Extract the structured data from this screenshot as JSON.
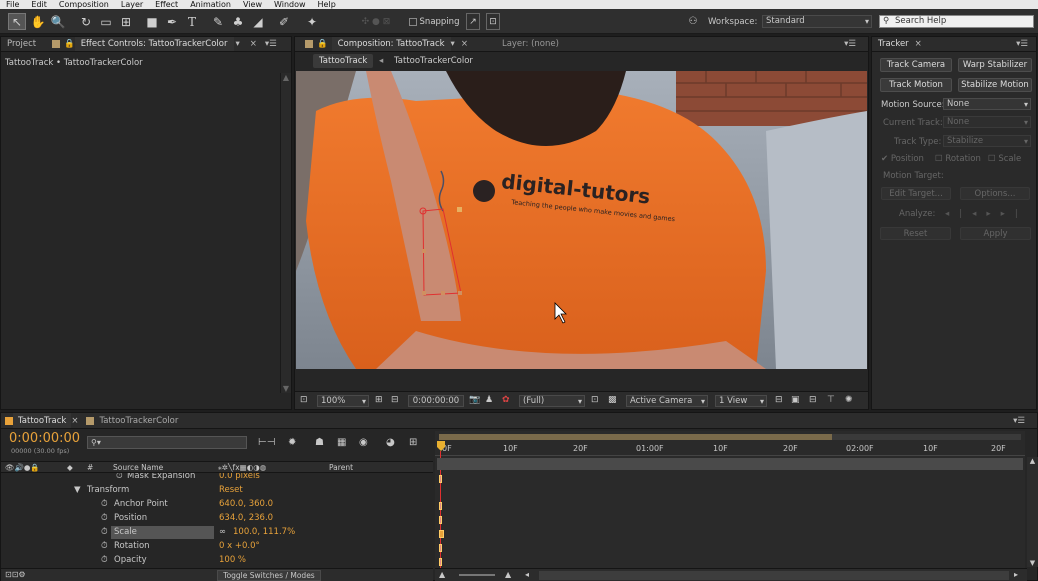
{
  "menu": [
    "File",
    "Edit",
    "Composition",
    "Layer",
    "Effect",
    "Animation",
    "View",
    "Window",
    "Help"
  ],
  "toolbar": {
    "snapping": "Snapping",
    "workspace_label": "Workspace:",
    "workspace_value": "Standard",
    "search_help": "Search Help"
  },
  "left_panel": {
    "tab_project": "Project",
    "tab_effects": "Effect Controls: TattooTrackerColor",
    "breadcrumb": "TattooTrack • TattooTrackerColor"
  },
  "comp_panel": {
    "tab_comp": "Composition: TattooTrack",
    "tab_layer": "Layer: (none)",
    "sub_tab1": "TattooTrack",
    "sub_tab2": "TattooTrackerColor",
    "shirt_logo": "digital-tutors",
    "shirt_tagline": "Teaching the people who make movies and games",
    "zoom": "100%",
    "timecode": "0:00:00:00",
    "resolution": "(Full)",
    "camera": "Active Camera",
    "views": "1 View"
  },
  "tracker": {
    "title": "Tracker",
    "track_camera": "Track Camera",
    "warp_stabilizer": "Warp Stabilizer",
    "track_motion": "Track Motion",
    "stabilize_motion": "Stabilize Motion",
    "motion_source_label": "Motion Source:",
    "motion_source_value": "None",
    "current_track_label": "Current Track:",
    "current_track_value": "None",
    "track_type_label": "Track Type:",
    "track_type_value": "Stabilize",
    "position": "Position",
    "rotation": "Rotation",
    "scale": "Scale",
    "motion_target": "Motion Target:",
    "edit_target": "Edit Target...",
    "options": "Options...",
    "analyze": "Analyze:",
    "reset": "Reset",
    "apply": "Apply"
  },
  "timeline": {
    "tab1": "TattooTrack",
    "tab2": "TattooTrackerColor",
    "timecode": "0:00:00:00",
    "frames": "00000 (30.00 fps)",
    "search_placeholder": "",
    "col_source": "Source Name",
    "col_parent": "Parent",
    "toggle": "Toggle Switches / Modes",
    "ruler": [
      "0F",
      "10F",
      "20F",
      "01:00F",
      "10F",
      "20F",
      "02:00F",
      "10F",
      "20F"
    ],
    "rows": [
      {
        "name": "Mask Expansion",
        "value": "0.0 pixels"
      },
      {
        "name": "Transform",
        "value": "Reset"
      },
      {
        "name": "Anchor Point",
        "value": "640.0, 360.0"
      },
      {
        "name": "Position",
        "value": "634.0, 236.0"
      },
      {
        "name": "Scale",
        "value": "100.0, 111.7%"
      },
      {
        "name": "Rotation",
        "value": "0 x +0.0°"
      },
      {
        "name": "Opacity",
        "value": "100 %"
      }
    ]
  }
}
